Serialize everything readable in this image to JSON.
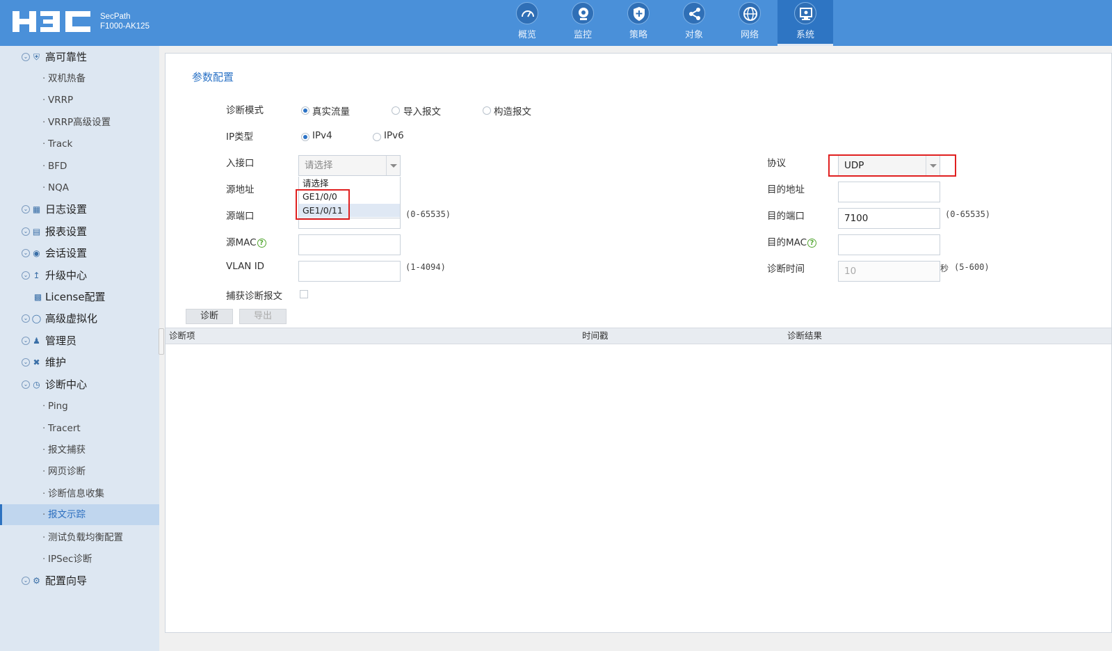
{
  "header": {
    "logo_text": "H3C",
    "product_line1": "SecPath",
    "product_line2": "F1000-AK125",
    "nav": [
      {
        "label": "概览",
        "icon": "gauge-icon"
      },
      {
        "label": "监控",
        "icon": "camera-icon"
      },
      {
        "label": "策略",
        "icon": "shield-icon"
      },
      {
        "label": "对象",
        "icon": "share-icon"
      },
      {
        "label": "网络",
        "icon": "globe-icon"
      },
      {
        "label": "系统",
        "icon": "monitor-icon",
        "active": true
      }
    ]
  },
  "sidebar": {
    "items": [
      {
        "label": "高可靠性",
        "level": "top",
        "icon": "shield-icon"
      },
      {
        "label": "双机热备",
        "level": "sub"
      },
      {
        "label": "VRRP",
        "level": "sub"
      },
      {
        "label": "VRRP高级设置",
        "level": "sub"
      },
      {
        "label": "Track",
        "level": "sub"
      },
      {
        "label": "BFD",
        "level": "sub"
      },
      {
        "label": "NQA",
        "level": "sub"
      },
      {
        "label": "日志设置",
        "level": "top",
        "icon": "log-icon"
      },
      {
        "label": "报表设置",
        "level": "top",
        "icon": "report-icon"
      },
      {
        "label": "会话设置",
        "level": "top",
        "icon": "chat-icon"
      },
      {
        "label": "升级中心",
        "level": "top",
        "icon": "upload-icon"
      },
      {
        "label": "License配置",
        "level": "top",
        "icon": "license-icon"
      },
      {
        "label": "高级虚拟化",
        "level": "top",
        "icon": "virtual-icon"
      },
      {
        "label": "管理员",
        "level": "top",
        "icon": "user-icon"
      },
      {
        "label": "维护",
        "level": "top",
        "icon": "wrench-icon"
      },
      {
        "label": "诊断中心",
        "level": "top",
        "icon": "diagnose-icon"
      },
      {
        "label": "Ping",
        "level": "sub"
      },
      {
        "label": "Tracert",
        "level": "sub"
      },
      {
        "label": "报文捕获",
        "level": "sub"
      },
      {
        "label": "网页诊断",
        "level": "sub"
      },
      {
        "label": "诊断信息收集",
        "level": "sub"
      },
      {
        "label": "报文示踪",
        "level": "sub",
        "active": true
      },
      {
        "label": "测试负载均衡配置",
        "level": "sub"
      },
      {
        "label": "IPSec诊断",
        "level": "sub"
      },
      {
        "label": "配置向导",
        "level": "top",
        "icon": "gear-icon"
      }
    ]
  },
  "form": {
    "title": "参数配置",
    "diag_mode_label": "诊断模式",
    "diag_mode_options": [
      "真实流量",
      "导入报文",
      "构造报文"
    ],
    "diag_mode_selected": "真实流量",
    "ip_type_label": "IP类型",
    "ip_type_options": [
      "IPv4",
      "IPv6"
    ],
    "ip_type_selected": "IPv4",
    "in_interface_label": "入接口",
    "in_interface_placeholder": "请选择",
    "in_interface_options": [
      "请选择",
      "GE1/0/0",
      "GE1/0/11"
    ],
    "src_addr_label": "源地址",
    "src_port_label": "源端口",
    "src_port_range": "(0-65535)",
    "src_mac_label": "源MAC",
    "vlan_label": "VLAN ID",
    "vlan_range": "(1-4094)",
    "capture_label": "捕获诊断报文",
    "protocol_label": "协议",
    "protocol_value": "UDP",
    "dst_addr_label": "目的地址",
    "dst_port_label": "目的端口",
    "dst_port_value": "7100",
    "dst_port_range": "(0-65535)",
    "dst_mac_label": "目的MAC",
    "diag_time_label": "诊断时间",
    "diag_time_value": "10",
    "diag_time_unit": "秒",
    "diag_time_range": "(5-600)",
    "help_glyph": "?"
  },
  "buttons": {
    "diagnose": "诊断",
    "export": "导出"
  },
  "table": {
    "headers": [
      "诊断项",
      "时间戳",
      "诊断结果"
    ]
  }
}
